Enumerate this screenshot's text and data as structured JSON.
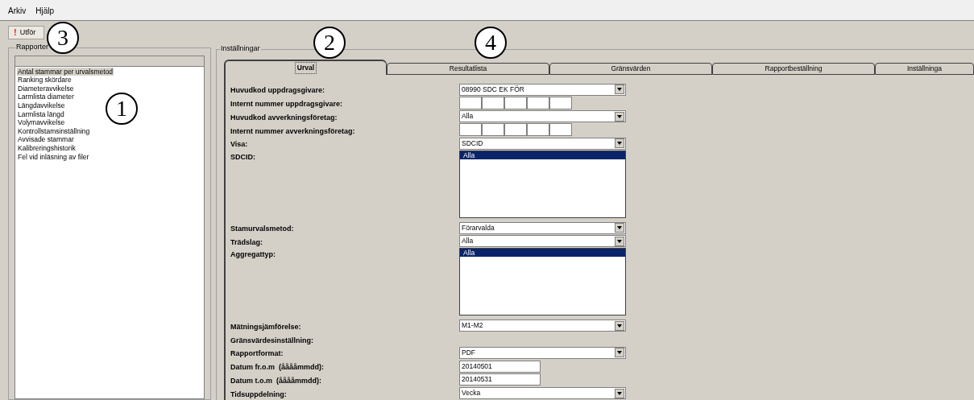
{
  "menu": [
    "Arkiv",
    "Hjälp"
  ],
  "toolbar": {
    "button": {
      "icon": "!",
      "label": "Utför"
    }
  },
  "reports": {
    "title": "Rapporter",
    "items": [
      {
        "label": "Antal stammar per urvalsmetod",
        "selected": true
      },
      {
        "label": "Ranking skördare",
        "selected": false
      },
      {
        "label": "Diameteravvikelse",
        "selected": false
      },
      {
        "label": "Larmlista diameter",
        "selected": false
      },
      {
        "label": "Längdavvikelse",
        "selected": false
      },
      {
        "label": "Larmlista längd",
        "selected": false
      },
      {
        "label": "Volymavvikelse",
        "selected": false
      },
      {
        "label": "Kontrollstamsinställning",
        "selected": false
      },
      {
        "label": "Avvisade stammar",
        "selected": false
      },
      {
        "label": "Kalibreringshistorik",
        "selected": false
      },
      {
        "label": "Fel vid inläsning av filer",
        "selected": false
      }
    ]
  },
  "settings": {
    "title": "Inställningar",
    "tabs": [
      {
        "label": "Urval",
        "selected": true
      },
      {
        "label": "Resultatlista",
        "selected": false
      },
      {
        "label": "Gränsvärden",
        "selected": false
      },
      {
        "label": "Rapportbeställning",
        "selected": false
      },
      {
        "label": "Inställninga",
        "selected": false
      }
    ],
    "fields": [
      {
        "kind": "select",
        "label": "Huvudkod uppdragsgivare:",
        "value": "08990 SDC EK FÖR"
      },
      {
        "kind": "boxes",
        "label": "Internt nummer uppdragsgivare:"
      },
      {
        "kind": "select",
        "label": "Huvudkod avverkningsföretag:",
        "value": "Alla"
      },
      {
        "kind": "boxes",
        "label": "Internt nummer avverkningsföretag:"
      },
      {
        "kind": "select",
        "label": "Visa:",
        "value": "SDCID"
      },
      {
        "kind": "listbox",
        "label": "SDCID:",
        "options": [
          {
            "label": "Alla",
            "selected": true
          }
        ]
      },
      {
        "kind": "select",
        "label": "Stamurvalsmetod:",
        "value": "Förarvalda"
      },
      {
        "kind": "select",
        "label": "Trädslag:",
        "value": "Alla"
      },
      {
        "kind": "listbox",
        "label": "Aggregattyp:",
        "options": [
          {
            "label": "Alla",
            "selected": true
          }
        ]
      },
      {
        "kind": "select",
        "label": "Mätningsjämförelse:",
        "value": "M1-M2"
      },
      {
        "kind": "heading",
        "label": "Gränsvärdesinställning:"
      },
      {
        "kind": "select",
        "label": "Rapportformat:",
        "value": "PDF"
      },
      {
        "kind": "text",
        "label": "Datum fr.o.m  (ååååmmdd):",
        "value": "20140501"
      },
      {
        "kind": "text",
        "label": "Datum t.o.m  (ååååmmdd):",
        "value": "20140531"
      },
      {
        "kind": "select",
        "label": "Tidsuppdelning:",
        "value": "Vecka"
      }
    ]
  },
  "callouts": [
    "3",
    "2",
    "4",
    "1"
  ]
}
